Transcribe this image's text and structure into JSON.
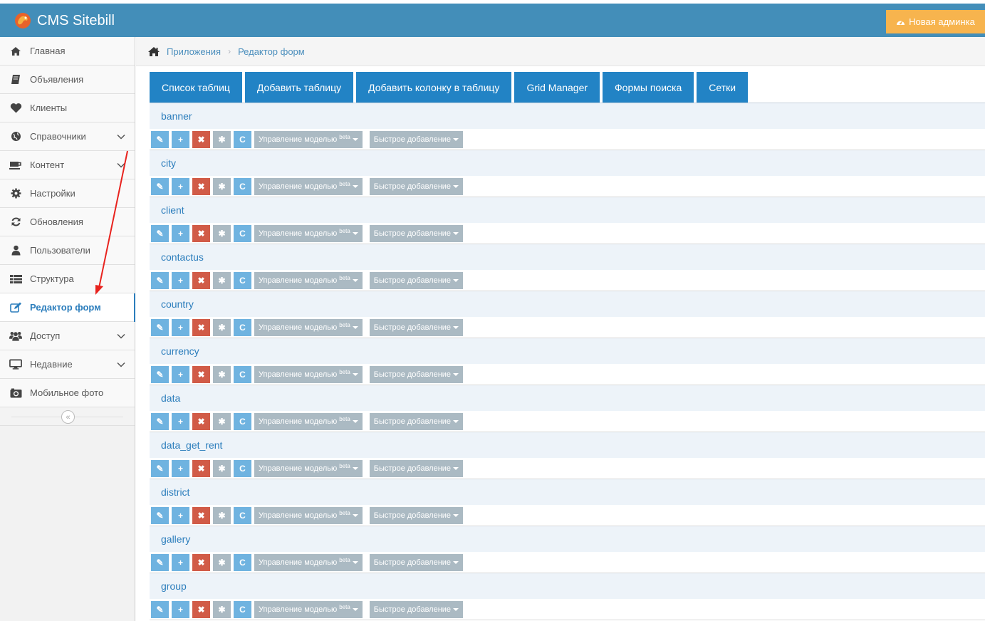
{
  "app": {
    "brand": "CMS Sitebill",
    "new_admin_label": "Новая админка"
  },
  "sidebar": {
    "items": [
      {
        "label": "Главная",
        "icon": "home-icon",
        "has_chevron": false,
        "active": false
      },
      {
        "label": "Объявления",
        "icon": "book-icon",
        "has_chevron": false,
        "active": false
      },
      {
        "label": "Клиенты",
        "icon": "heart-icon",
        "has_chevron": false,
        "active": false
      },
      {
        "label": "Справочники",
        "icon": "globe-icon",
        "has_chevron": true,
        "active": false
      },
      {
        "label": "Контент",
        "icon": "coffee-icon",
        "has_chevron": true,
        "active": false
      },
      {
        "label": "Настройки",
        "icon": "gear-icon",
        "has_chevron": false,
        "active": false
      },
      {
        "label": "Обновления",
        "icon": "refresh-icon",
        "has_chevron": false,
        "active": false
      },
      {
        "label": "Пользователи",
        "icon": "user-icon",
        "has_chevron": false,
        "active": false
      },
      {
        "label": "Структура",
        "icon": "list-icon",
        "has_chevron": false,
        "active": false
      },
      {
        "label": "Редактор форм",
        "icon": "edit-icon",
        "has_chevron": false,
        "active": true
      },
      {
        "label": "Доступ",
        "icon": "users-icon",
        "has_chevron": true,
        "active": false
      },
      {
        "label": "Недавние",
        "icon": "desktop-icon",
        "has_chevron": true,
        "active": false
      },
      {
        "label": "Мобильное фото",
        "icon": "camera-icon",
        "has_chevron": false,
        "active": false
      }
    ],
    "collapse_glyph": "«"
  },
  "breadcrumb": {
    "items": [
      "Приложения",
      "Редактор форм"
    ],
    "separator": "›"
  },
  "tabs": [
    "Список таблиц",
    "Добавить таблицу",
    "Добавить колонку в таблицу",
    "Grid Manager",
    "Формы поиска",
    "Сетки"
  ],
  "row_controls": {
    "model_menu_label": "Управление моделью",
    "model_menu_badge": "beta",
    "quick_add_label": "Быстрое добавление",
    "edit_glyph": "✎",
    "add_glyph": "+",
    "delete_glyph": "✖",
    "star_glyph": "✱",
    "refresh_glyph": "C"
  },
  "tables": [
    "banner",
    "city",
    "client",
    "contactus",
    "country",
    "currency",
    "data",
    "data_get_rent",
    "district",
    "gallery",
    "group"
  ],
  "colors": {
    "topbar": "#438eb9",
    "tab": "#2283c5",
    "new_admin": "#f7b44e",
    "action_blue": "#6fb3e0",
    "action_red": "#d15b47",
    "action_grey": "#abbac3",
    "annotation_arrow": "#e8231e"
  }
}
